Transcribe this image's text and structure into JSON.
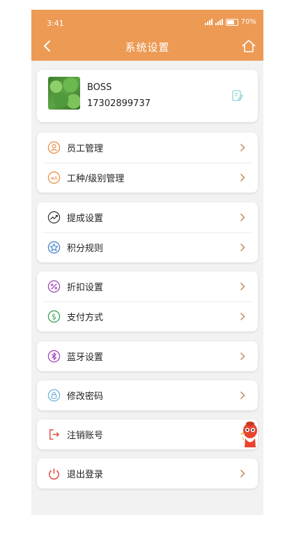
{
  "status_bar": {
    "time": "3:41",
    "battery": "70%"
  },
  "nav": {
    "title": "系统设置"
  },
  "profile": {
    "name": "BOSS",
    "phone": "17302899737"
  },
  "groups": [
    {
      "items": [
        {
          "label": "员工管理",
          "icon": "staff-icon"
        },
        {
          "label": "工种/级别管理",
          "icon": "level-icon"
        }
      ]
    },
    {
      "items": [
        {
          "label": "提成设置",
          "icon": "trend-icon"
        },
        {
          "label": "积分规则",
          "icon": "star-icon"
        }
      ]
    },
    {
      "items": [
        {
          "label": "折扣设置",
          "icon": "discount-icon"
        },
        {
          "label": "支付方式",
          "icon": "dollar-icon"
        }
      ]
    },
    {
      "items": [
        {
          "label": "蓝牙设置",
          "icon": "bluetooth-icon"
        }
      ]
    },
    {
      "items": [
        {
          "label": "修改密码",
          "icon": "lock-icon"
        }
      ]
    },
    {
      "items": [
        {
          "label": "注销账号",
          "icon": "logout-icon"
        }
      ]
    },
    {
      "items": [
        {
          "label": "退出登录",
          "icon": "power-icon"
        }
      ]
    }
  ],
  "colors": {
    "header": "#ec9a54",
    "accent": "#e8893b",
    "chevron": "#c08a5a"
  }
}
